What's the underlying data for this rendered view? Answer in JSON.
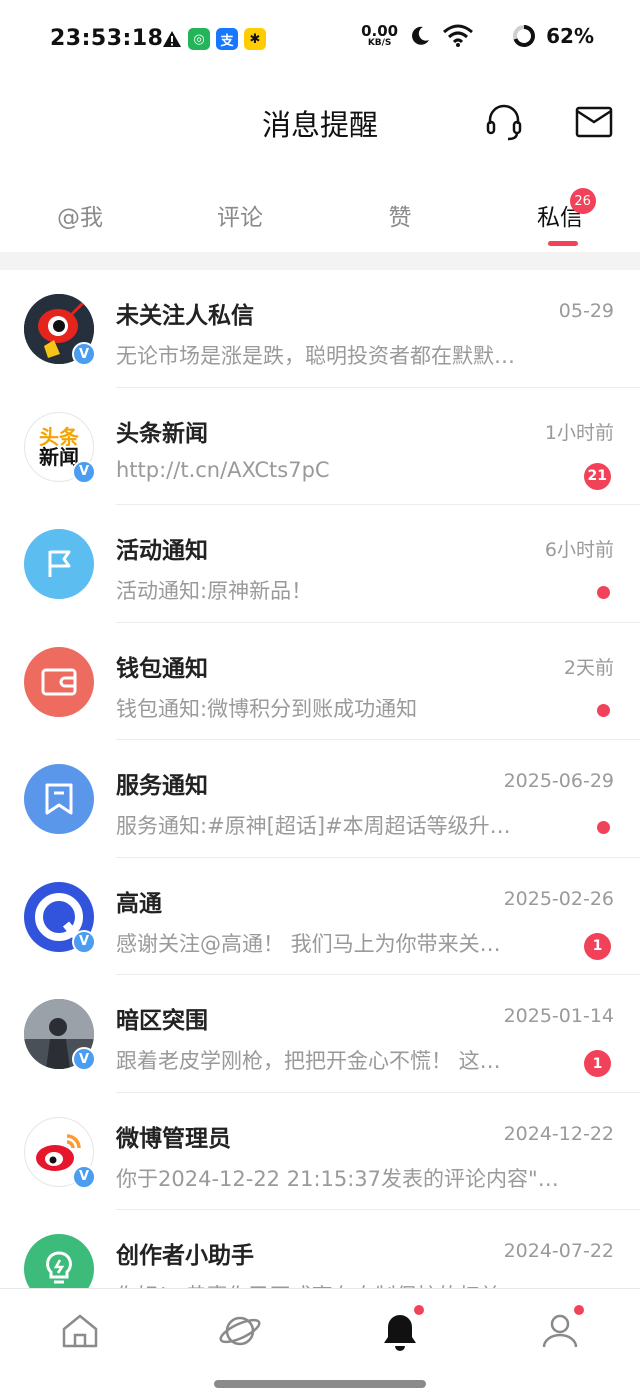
{
  "status_bar": {
    "time": "23:53:18",
    "net_speed_value": "0.00",
    "net_speed_unit": "KB/S",
    "battery": "62%",
    "icons": [
      "warning-icon",
      "wechat-icon",
      "alipay-icon",
      "app-icon",
      "moon-icon",
      "wifi-icon",
      "battery-ring-icon"
    ]
  },
  "header": {
    "title": "消息提醒",
    "icons": [
      "headset-icon",
      "mail-icon"
    ]
  },
  "tabs": [
    {
      "label": "@我"
    },
    {
      "label": "评论"
    },
    {
      "label": "赞"
    },
    {
      "label": "私信",
      "badge": "26",
      "active": true
    }
  ],
  "messages": [
    {
      "name": "未关注人私信",
      "time": "05-29",
      "preview": "无论市场是涨是跌，聪明投资者都在默默…",
      "indicator": "none",
      "avatar": "sina-mascot",
      "verified": true
    },
    {
      "name": "头条新闻",
      "time": "1小时前",
      "preview": "http://t.cn/AXCts7pC",
      "indicator": "count",
      "count": "21",
      "avatar": "toutiao-logo",
      "avatar_text_top": "头条",
      "avatar_text_bottom": "新闻",
      "verified": true
    },
    {
      "name": "活动通知",
      "time": "6小时前",
      "preview": "活动通知:原神新品！",
      "indicator": "dot",
      "avatar": "flag-icon",
      "verified": false
    },
    {
      "name": "钱包通知",
      "time": "2天前",
      "preview": "钱包通知:微博积分到账成功通知",
      "indicator": "dot",
      "avatar": "wallet-icon",
      "verified": false
    },
    {
      "name": "服务通知",
      "time": "2025-06-29",
      "preview": "服务通知:#原神[超话]#本周超话等级升…",
      "indicator": "dot",
      "avatar": "bookmark-icon",
      "verified": false
    },
    {
      "name": "高通",
      "time": "2025-02-26",
      "preview": "感谢关注@高通！ 我们马上为你带来关…",
      "indicator": "count",
      "count": "1",
      "avatar": "qualcomm-logo",
      "verified": true
    },
    {
      "name": "暗区突围",
      "time": "2025-01-14",
      "preview": "跟着老皮学刚枪，把把开金心不慌！ 这…",
      "indicator": "count",
      "count": "1",
      "avatar": "game-avatar",
      "verified": true
    },
    {
      "name": "微博管理员",
      "time": "2024-12-22",
      "preview": "你于2024-12-22 21:15:37发表的评论内容\"…",
      "indicator": "none",
      "avatar": "weibo-logo",
      "verified": true
    },
    {
      "name": "创作者小助手",
      "time": "2024-07-22",
      "preview": "你好！ 恭喜你已正式享有自制保护的权益…",
      "indicator": "none",
      "avatar": "lightbulb-icon",
      "verified": false
    }
  ],
  "bottom_nav": [
    {
      "icon": "home-icon",
      "dot": false
    },
    {
      "icon": "planet-icon",
      "dot": false
    },
    {
      "icon": "bell-icon",
      "dot": true,
      "active": true
    },
    {
      "icon": "profile-icon",
      "dot": true
    }
  ],
  "colors": {
    "accent": "#f2425a",
    "verified": "#4a9df0",
    "activity": "#5bbdf0",
    "wallet": "#ee6b60",
    "service": "#5a96ea",
    "creator": "#3dbb7a"
  }
}
